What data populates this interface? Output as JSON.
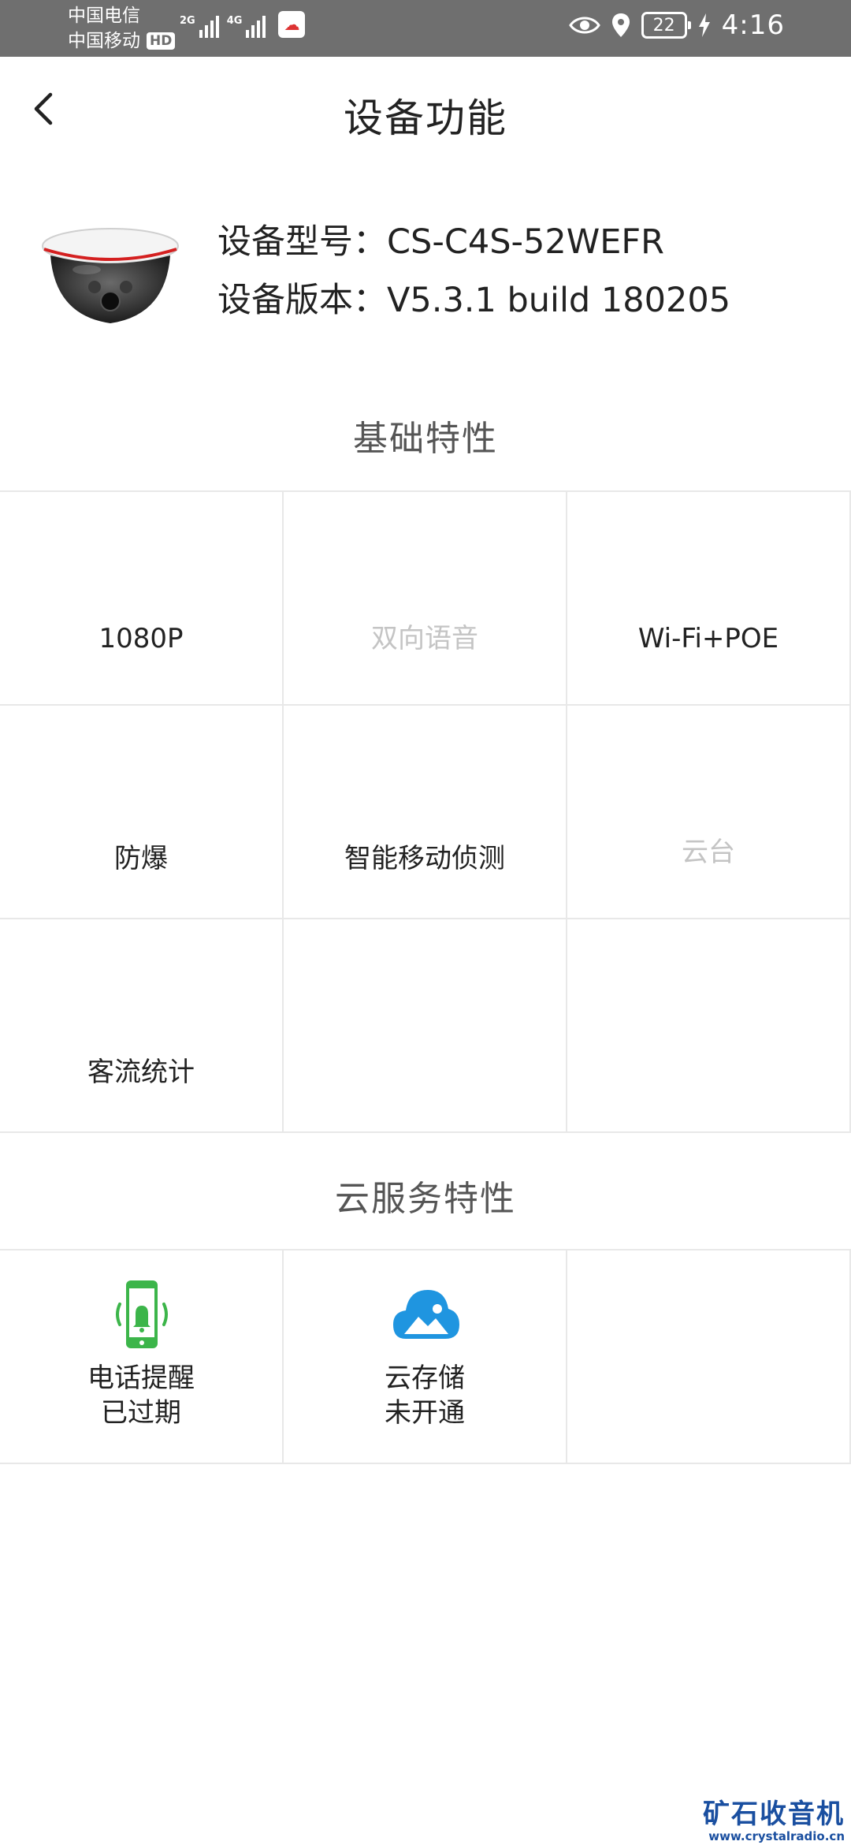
{
  "status_bar": {
    "carrier_1": "中国电信",
    "carrier_2": "中国移动",
    "hd_badge": "HD",
    "signal_1_tag": "2G",
    "signal_2_tag": "4G",
    "battery_level": "22",
    "time": "4:16"
  },
  "header": {
    "title": "设备功能",
    "back_icon": "chevron-left-icon"
  },
  "device": {
    "model_line": "设备型号：CS-C4S-52WEFR",
    "version_line": "设备版本：V5.3.1 build 180205"
  },
  "basic_features": {
    "title": "基础特性",
    "items": [
      {
        "label": "1080P",
        "enabled": true
      },
      {
        "label": "双向语音",
        "enabled": false
      },
      {
        "label": "Wi-Fi+POE",
        "enabled": true
      },
      {
        "label": "防爆",
        "enabled": true
      },
      {
        "label": "智能移动侦测",
        "enabled": true
      },
      {
        "label": "云台",
        "enabled": false
      },
      {
        "label": "客流统计",
        "enabled": true
      },
      {
        "label": "",
        "enabled": false
      },
      {
        "label": "",
        "enabled": false
      }
    ]
  },
  "cloud_features": {
    "title": "云服务特性",
    "items": [
      {
        "name": "电话提醒",
        "status": "已过期",
        "icon": "phone-bell-icon",
        "color": "#3cb54a"
      },
      {
        "name": "云存储",
        "status": "未开通",
        "icon": "cloud-storage-icon",
        "color": "#1f95e0"
      },
      {
        "name": "",
        "status": "",
        "icon": "",
        "color": ""
      }
    ]
  },
  "watermark": {
    "main": "矿石收音机",
    "url": "www.crystalradio.cn"
  }
}
